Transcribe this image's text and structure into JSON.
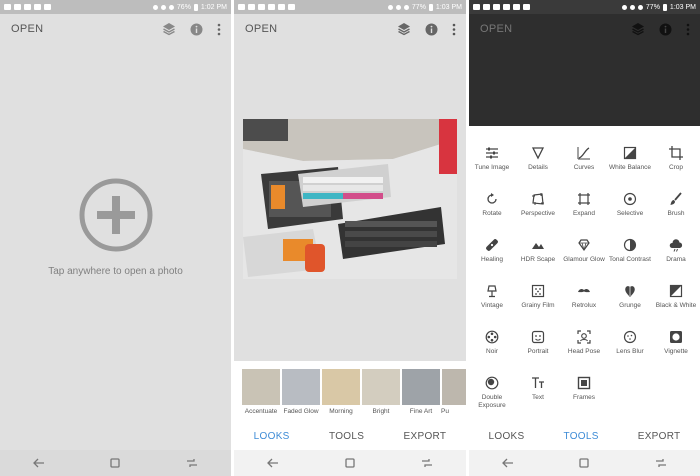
{
  "panel1": {
    "status": {
      "battery": "76%",
      "time": "1:02 PM"
    },
    "open_label": "OPEN",
    "tap_text": "Tap anywhere to open a photo"
  },
  "panel2": {
    "status": {
      "battery": "77%",
      "time": "1:03 PM"
    },
    "open_label": "OPEN",
    "looks": [
      "Accentuate",
      "Faded Glow",
      "Morning",
      "Bright",
      "Fine Art",
      "Pu"
    ],
    "tabs": {
      "looks": "LOOKS",
      "tools": "TOOLS",
      "export": "EXPORT"
    },
    "active_tab": "looks"
  },
  "panel3": {
    "status": {
      "battery": "77%",
      "time": "1:03 PM"
    },
    "open_label": "OPEN",
    "tools": [
      {
        "label": "Tune Image",
        "icon": "tune-icon"
      },
      {
        "label": "Details",
        "icon": "triangle-icon"
      },
      {
        "label": "Curves",
        "icon": "curves-icon"
      },
      {
        "label": "White Balance",
        "icon": "white-balance-icon"
      },
      {
        "label": "Crop",
        "icon": "crop-icon"
      },
      {
        "label": "Rotate",
        "icon": "rotate-icon"
      },
      {
        "label": "Perspective",
        "icon": "perspective-icon"
      },
      {
        "label": "Expand",
        "icon": "expand-icon"
      },
      {
        "label": "Selective",
        "icon": "selective-icon"
      },
      {
        "label": "Brush",
        "icon": "brush-icon"
      },
      {
        "label": "Healing",
        "icon": "bandage-icon"
      },
      {
        "label": "HDR Scape",
        "icon": "mountain-icon"
      },
      {
        "label": "Glamour Glow",
        "icon": "diamond-icon"
      },
      {
        "label": "Tonal Contrast",
        "icon": "contrast-icon"
      },
      {
        "label": "Drama",
        "icon": "cloud-icon"
      },
      {
        "label": "Vintage",
        "icon": "lamp-icon"
      },
      {
        "label": "Grainy Film",
        "icon": "film-icon"
      },
      {
        "label": "Retrolux",
        "icon": "mustache-icon"
      },
      {
        "label": "Grunge",
        "icon": "grunge-icon"
      },
      {
        "label": "Black & White",
        "icon": "black-white-icon"
      },
      {
        "label": "Noir",
        "icon": "reel-icon"
      },
      {
        "label": "Portrait",
        "icon": "portrait-icon"
      },
      {
        "label": "Head Pose",
        "icon": "head-pose-icon"
      },
      {
        "label": "Lens Blur",
        "icon": "lens-blur-icon"
      },
      {
        "label": "Vignette",
        "icon": "vignette-icon"
      },
      {
        "label": "Double Exposure",
        "icon": "double-exposure-icon"
      },
      {
        "label": "Text",
        "icon": "text-icon"
      },
      {
        "label": "Frames",
        "icon": "frame-icon"
      }
    ],
    "tabs": {
      "looks": "LOOKS",
      "tools": "TOOLS",
      "export": "EXPORT"
    },
    "active_tab": "tools"
  },
  "colors": {
    "accent": "#3d8bd6",
    "panel_gray": "#e0e0e0",
    "dark_overlay": "#2e2e2e"
  }
}
